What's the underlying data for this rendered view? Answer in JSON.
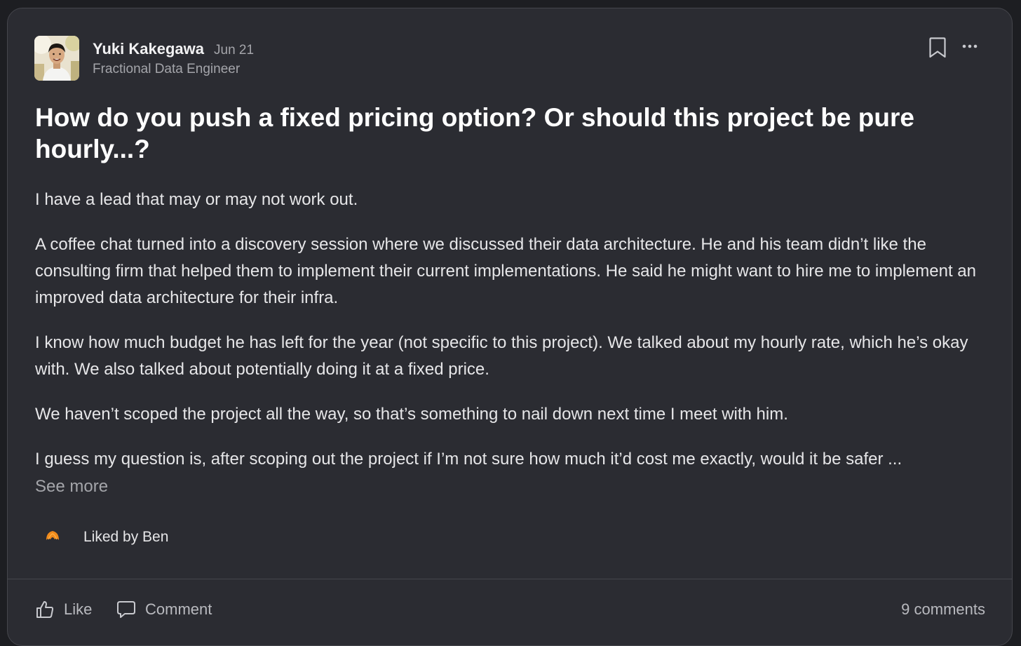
{
  "post": {
    "author": {
      "name": "Yuki Kakegawa",
      "role": "Fractional Data Engineer",
      "avatar_icon": "profile-photo"
    },
    "date": "Jun 21",
    "title": "How do you push a fixed pricing option? Or should this project be pure hourly...?",
    "body": [
      "I have a lead that may or may not work out.",
      "A coffee chat turned into a discovery session where we discussed their data architecture. He and his team didn’t like the consulting firm that helped them to implement their current implementations. He said he might want to hire me to implement an improved data architecture for their infra.",
      "I know how much budget he has left for the year (not specific to this project). We talked about my hourly rate, which he’s okay with. We also talked about potentially doing it at a fixed price.",
      "We haven’t scoped the project all the way, so that’s something to nail down next time I meet with him.",
      "I guess my question is, after scoping out the project if I’m not sure how much it’d cost me exactly, would it be safer ..."
    ],
    "see_more": "See more",
    "liked_by": "Liked by Ben"
  },
  "actions": {
    "like": "Like",
    "comment": "Comment",
    "comments_count": "9 comments"
  },
  "icons": {
    "bookmark": "bookmark-icon",
    "more": "more-icon",
    "like": "thumbs-up-icon",
    "comment": "comment-bubble-icon",
    "liker": "liker-avatar-icon"
  },
  "colors": {
    "background": "#2b2c32",
    "text": "#e6e6e8",
    "muted": "#a4a5aa",
    "liker_orange": "#f08a1c"
  }
}
